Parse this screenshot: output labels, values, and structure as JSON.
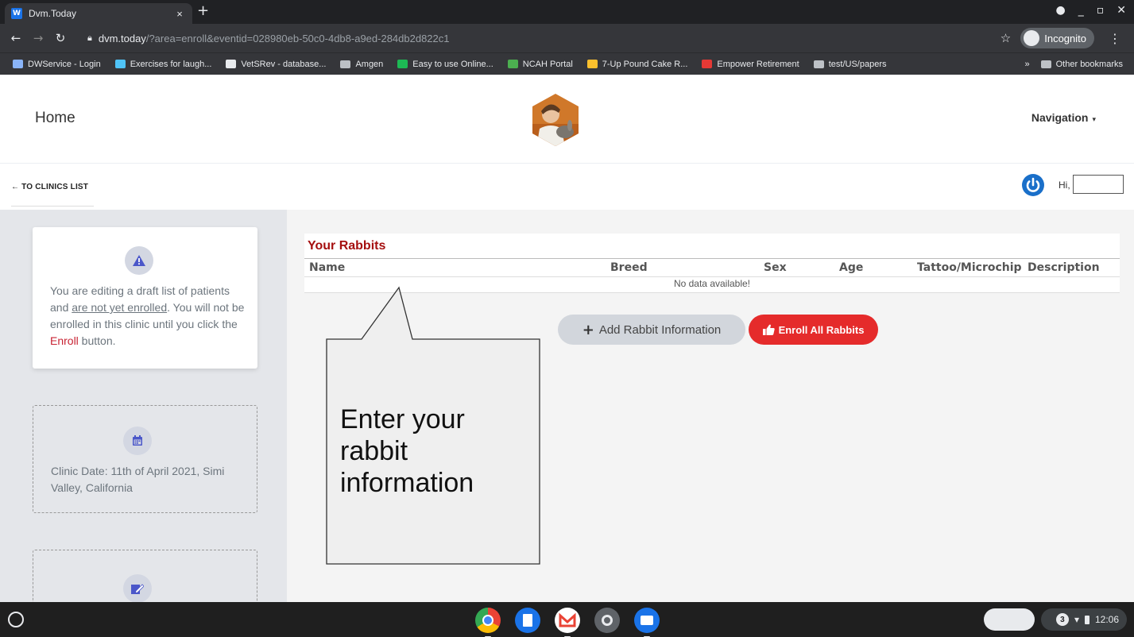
{
  "browser": {
    "tab_title": "Dvm.Today",
    "tab_favicon": "W",
    "tab_close": "×",
    "new_tab": "+",
    "url_host": "dvm.today",
    "url_path": "/?area=enroll&eventid=028980eb-50c0-4db8-a9ed-284db2d822c1",
    "profile_label": "Incognito",
    "bookmarks": [
      {
        "label": "DWService - Login",
        "color": "#8ab4f8"
      },
      {
        "label": "Exercises for laugh...",
        "color": "#4fc3f7"
      },
      {
        "label": "VetSRev - database...",
        "color": "#e8eaed"
      },
      {
        "label": "Amgen",
        "color": "folder"
      },
      {
        "label": "Easy to use Online...",
        "color": "#1db954"
      },
      {
        "label": "NCAH Portal",
        "color": "#4caf50"
      },
      {
        "label": "7-Up Pound Cake R...",
        "color": "#fbc02d"
      },
      {
        "label": "Empower Retirement",
        "color": "#e53935"
      },
      {
        "label": "test/US/papers",
        "color": "folder"
      }
    ],
    "bookmarks_overflow": "»",
    "other_bookmarks": "Other bookmarks"
  },
  "header": {
    "home": "Home",
    "navigation": "Navigation",
    "navigation_caret": "▾"
  },
  "back_link": "← TO CLINICS LIST",
  "user": {
    "greeting": "Hi,"
  },
  "sidebar": {
    "warning_text_1": "You are editing a draft list of patients and ",
    "warning_link": "are not yet enrolled",
    "warning_text_2": ". You will not be enrolled in this clinic until you click the ",
    "warning_enroll": "Enroll",
    "warning_text_3": " button.",
    "clinic_date": "Clinic Date: 11th of April 2021, Simi Valley, California"
  },
  "table": {
    "title": "Your Rabbits",
    "columns": [
      "Name",
      "Breed",
      "Sex",
      "Age",
      "Tattoo/Microchip",
      "Description"
    ],
    "empty_message": "No data available!"
  },
  "actions": {
    "add_label": "Add Rabbit Information",
    "add_plus": "+",
    "enroll_label": "Enroll All Rabbits"
  },
  "callout": {
    "text": "Enter your rabbit information"
  },
  "shelf": {
    "notification_count": "3",
    "time": "12:06"
  },
  "colors": {
    "accent_red": "#e52b2b",
    "title_red": "#a50f0f",
    "power_blue": "#1a6fc9"
  }
}
